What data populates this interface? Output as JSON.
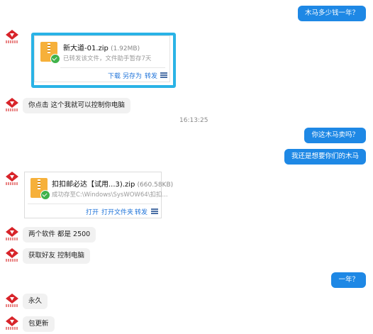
{
  "messages": {
    "m1": "木马多少钱一年？",
    "file1": {
      "name": "新大道-01.zip",
      "size": "(1.92MB)",
      "status": "已转发该文件，文件助手暂存7天",
      "actions": [
        "下载",
        "另存为",
        "转发"
      ]
    },
    "m2": "你点击 这个我就可以控制你电脑",
    "time": "16:13:25",
    "m3": "你这木马卖吗？",
    "m4": "我还是想要你们的木马",
    "file2": {
      "name": "扣扣邮必达【试用...3).zip",
      "size": "(660.58KB)",
      "status": "成功存至C:\\Windows\\SysWOW64\\扣扣...",
      "actions": [
        "打开",
        "打开文件夹",
        "转发"
      ]
    },
    "m5": "两个软件 都是 2500",
    "m6": "获取好友 控制电脑",
    "m7": "一年？",
    "m8": "永久",
    "m9": "包更新"
  },
  "colors": {
    "outgoing_bubble": "#1e88e5",
    "incoming_bubble": "#f1f1f1",
    "highlight_border": "#2ab3e6",
    "link": "#1e73d9",
    "avatar_red": "#d8242a"
  },
  "icons": {
    "avatar": "red-diamond-logo-icon",
    "zip": "zip-file-icon",
    "success": "green-check-icon",
    "menu": "menu-icon"
  }
}
